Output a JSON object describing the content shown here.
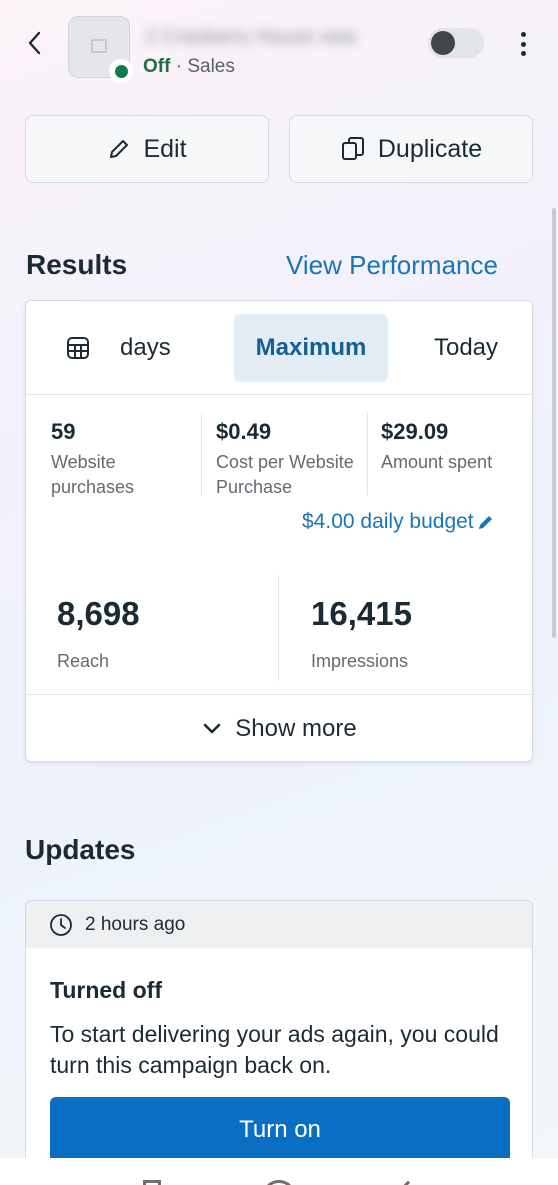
{
  "header": {
    "campaign_name": "2 Cranberry House new",
    "status": "Off",
    "separator": "·",
    "objective": "Sales"
  },
  "actions": {
    "edit_label": "Edit",
    "duplicate_label": "Duplicate"
  },
  "results": {
    "title": "Results",
    "view_performance": "View Performance",
    "date_options": {
      "days": "days",
      "maximum": "Maximum",
      "today": "Today"
    },
    "metrics": [
      {
        "value": "59",
        "label": "Website purchases"
      },
      {
        "value": "$0.49",
        "label": "Cost per Website Purchase"
      },
      {
        "value": "$29.09",
        "label": "Amount spent"
      }
    ],
    "budget": "$4.00 daily budget",
    "reach": {
      "value": "8,698",
      "label": "Reach"
    },
    "impressions": {
      "value": "16,415",
      "label": "Impressions"
    },
    "show_more": "Show more"
  },
  "updates": {
    "title": "Updates",
    "time": "2 hours ago",
    "item_title": "Turned off",
    "item_body": "To start delivering your ads again, you could turn this campaign back on.",
    "button": "Turn on"
  },
  "colors": {
    "accent": "#1a75b8",
    "primary_button": "#0a6fc2",
    "status_off": "#0d7c4f"
  }
}
